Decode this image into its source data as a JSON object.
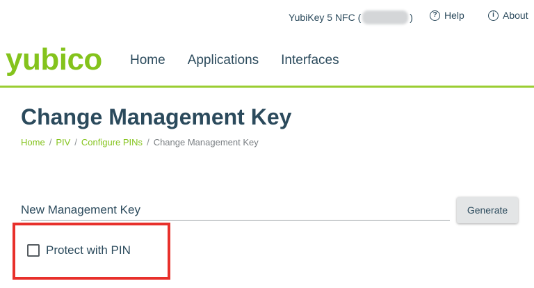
{
  "topbar": {
    "device_label": "YubiKey 5 NFC (",
    "device_label_end": ")",
    "help_label": "Help",
    "about_label": "About"
  },
  "brand": {
    "logo_text": "yubico",
    "accent_color": "#84c31c"
  },
  "nav": {
    "items": [
      "Home",
      "Applications",
      "Interfaces"
    ]
  },
  "page": {
    "title": "Change Management Key"
  },
  "breadcrumb": {
    "items": [
      "Home",
      "PIV",
      "Configure PINs"
    ],
    "current": "Change Management Key",
    "separator": "/"
  },
  "form": {
    "key_field_label": "New Management Key",
    "key_field_value": "",
    "generate_label": "Generate",
    "protect_pin_label": "Protect with PIN",
    "protect_pin_checked": false
  },
  "icons": {
    "help": "question-circle-icon",
    "about": "info-circle-icon"
  },
  "highlight_color": "#e8302b"
}
